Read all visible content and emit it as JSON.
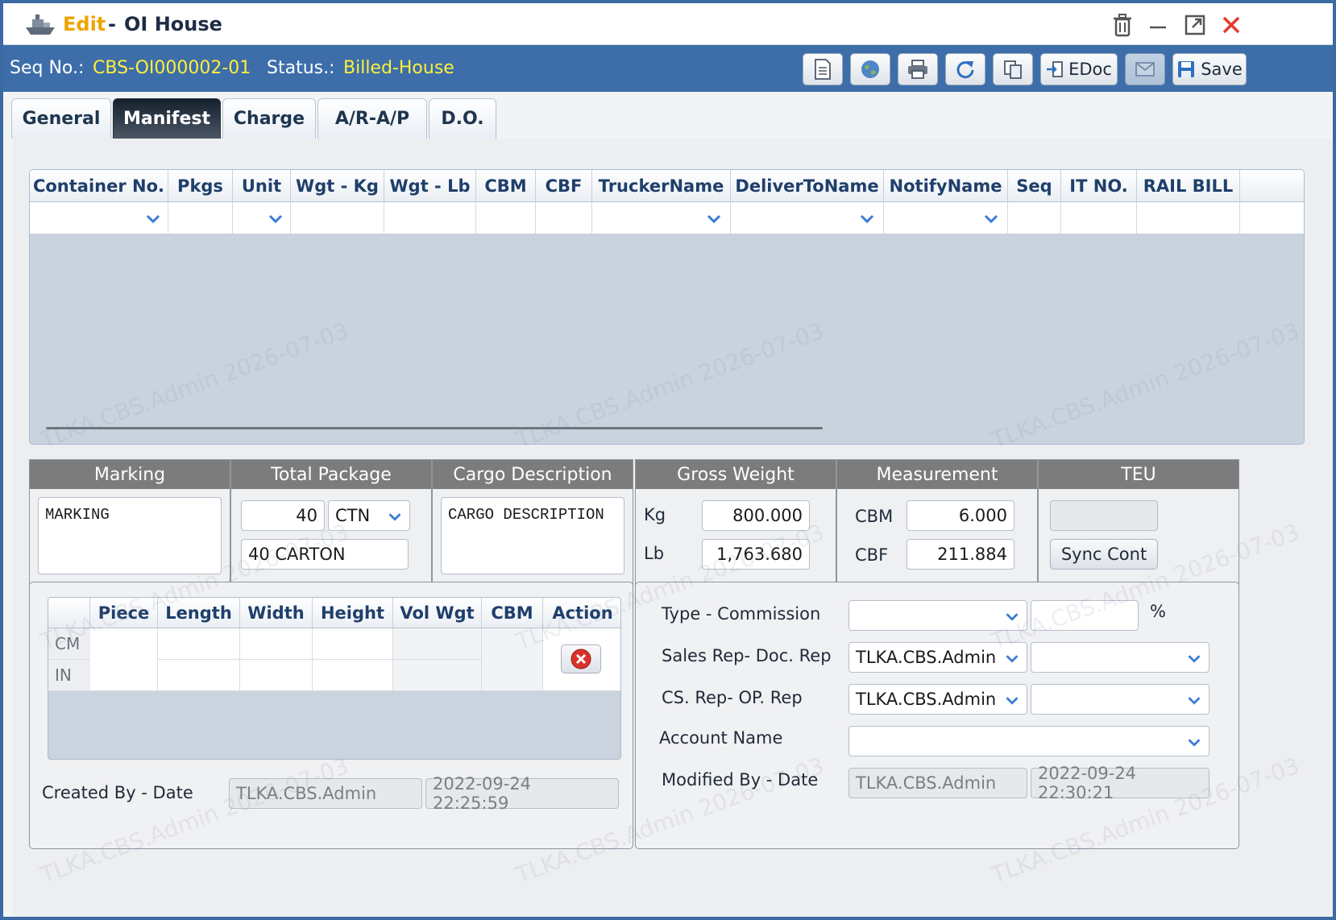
{
  "window": {
    "edit_label": "Edit",
    "dash": "-",
    "title": "OI House"
  },
  "info": {
    "seq_label": "Seq No.:",
    "seq_value": "CBS-OI000002-01",
    "status_label": "Status.:",
    "status_value": "Billed-House"
  },
  "toolbar": {
    "edoc_label": "EDoc",
    "save_label": "Save"
  },
  "tabs": [
    {
      "label": "General"
    },
    {
      "label": "Manifest",
      "active": true
    },
    {
      "label": "Charge"
    },
    {
      "label": "A/R-A/P"
    },
    {
      "label": "D.O."
    }
  ],
  "container_grid": {
    "columns": [
      "Container No.",
      "Pkgs",
      "Unit",
      "Wgt - Kg",
      "Wgt - Lb",
      "CBM",
      "CBF",
      "TruckerName",
      "DeliverToName",
      "NotifyName",
      "Seq",
      "IT NO.",
      "RAIL BILL"
    ],
    "rows": []
  },
  "marking": {
    "header": "Marking",
    "value": "MARKING"
  },
  "total_package": {
    "header": "Total Package",
    "count": "40",
    "unit": "CTN",
    "text": "40 CARTON"
  },
  "cargo": {
    "header": "Cargo Description",
    "value": "CARGO DESCRIPTION"
  },
  "gross_weight": {
    "header": "Gross Weight",
    "kg_label": "Kg",
    "kg_value": "800.000",
    "lb_label": "Lb",
    "lb_value": "1,763.680"
  },
  "measurement": {
    "header": "Measurement",
    "cbm_label": "CBM",
    "cbm_value": "6.000",
    "cbf_label": "CBF",
    "cbf_value": "211.884"
  },
  "teu": {
    "header": "TEU",
    "value": "",
    "sync_label": "Sync Cont"
  },
  "dimension_grid": {
    "columns": [
      "Piece",
      "Length",
      "Width",
      "Height",
      "Vol Wgt",
      "CBM",
      "Action"
    ],
    "units": [
      "CM",
      "IN"
    ]
  },
  "created": {
    "label": "Created By - Date",
    "by": "TLKA.CBS.Admin",
    "date": "2022-09-24 22:25:59"
  },
  "right_form": {
    "type_label": "Type - Commission",
    "type_value": "",
    "commission_value": "",
    "percent": "%",
    "sales_label": "Sales Rep- Doc. Rep",
    "sales_value": "TLKA.CBS.Admin",
    "doc_value": "",
    "cs_label": "CS. Rep- OP. Rep",
    "cs_value": "TLKA.CBS.Admin",
    "op_value": "",
    "account_label": "Account Name",
    "account_value": "",
    "modified_label": "Modified By - Date",
    "modified_by": "TLKA.CBS.Admin",
    "modified_date": "2022-09-24 22:30:21"
  },
  "watermark": "TLKA.CBS.Admin 2026-07-03"
}
